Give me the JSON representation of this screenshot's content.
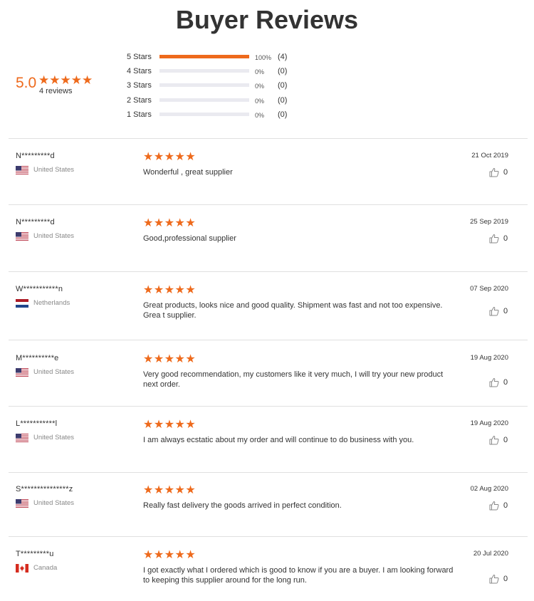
{
  "page": {
    "title": "Buyer Reviews"
  },
  "summary": {
    "average": "5.0",
    "stars": "★★★★★",
    "total_label": "4 reviews",
    "histogram": [
      {
        "label": "5 Stars",
        "fraction": 1.0,
        "percent": "100%",
        "count": "(4)"
      },
      {
        "label": "4 Stars",
        "fraction": 0.0,
        "percent": "0%",
        "count": "(0)"
      },
      {
        "label": "3 Stars",
        "fraction": 0.0,
        "percent": "0%",
        "count": "(0)"
      },
      {
        "label": "2 Stars",
        "fraction": 0.0,
        "percent": "0%",
        "count": "(0)"
      },
      {
        "label": "1 Stars",
        "fraction": 0.0,
        "percent": "0%",
        "count": "(0)"
      }
    ]
  },
  "colors": {
    "accent": "#ee6a1c",
    "divider": "#e0e0e0",
    "bar_track": "#eaeaf0"
  },
  "reviews": [
    {
      "reviewer": "N*********d",
      "country": "United States",
      "flag": "us-flag",
      "rating": 5,
      "stars": "★★★★★",
      "text": "Wonderful , great supplier",
      "date": "21 Oct 2019",
      "likes": "0"
    },
    {
      "reviewer": "N*********d",
      "country": "United States",
      "flag": "us-flag",
      "rating": 5,
      "stars": "★★★★★",
      "text": "Good,professional supplier",
      "date": "25 Sep 2019",
      "likes": "0"
    },
    {
      "reviewer": "W***********n",
      "country": "Netherlands",
      "flag": "nl-flag",
      "rating": 5,
      "stars": "★★★★★",
      "text": "Great products, looks nice and good quality. Shipment was fast and not too expensive. Grea t supplier.",
      "date": "07 Sep 2020",
      "likes": "0"
    },
    {
      "reviewer": "M**********e",
      "country": "United States",
      "flag": "us-flag",
      "rating": 5,
      "stars": "★★★★★",
      "text": "Very good recommendation, my customers like it very much, I will try your new product next order.",
      "date": "19 Aug 2020",
      "likes": "0"
    },
    {
      "reviewer": "L***********l",
      "country": "United States",
      "flag": "us-flag",
      "rating": 5,
      "stars": "★★★★★",
      "text": "I am always ecstatic about my order and will continue to do business with you.",
      "date": "19 Aug 2020",
      "likes": "0"
    },
    {
      "reviewer": "S***************z",
      "country": "United States",
      "flag": "us-flag",
      "rating": 5,
      "stars": "★★★★★",
      "text": "Really fast delivery the goods arrived in perfect condition.",
      "date": "02 Aug 2020",
      "likes": "0"
    },
    {
      "reviewer": "T*********u",
      "country": "Canada",
      "flag": "ca-flag",
      "rating": 5,
      "stars": "★★★★★",
      "text": "I got exactly what I ordered which is good to know if you are a buyer. I am looking forward to keeping this supplier around for the long run.",
      "date": "20 Jul 2020",
      "likes": "0"
    }
  ]
}
